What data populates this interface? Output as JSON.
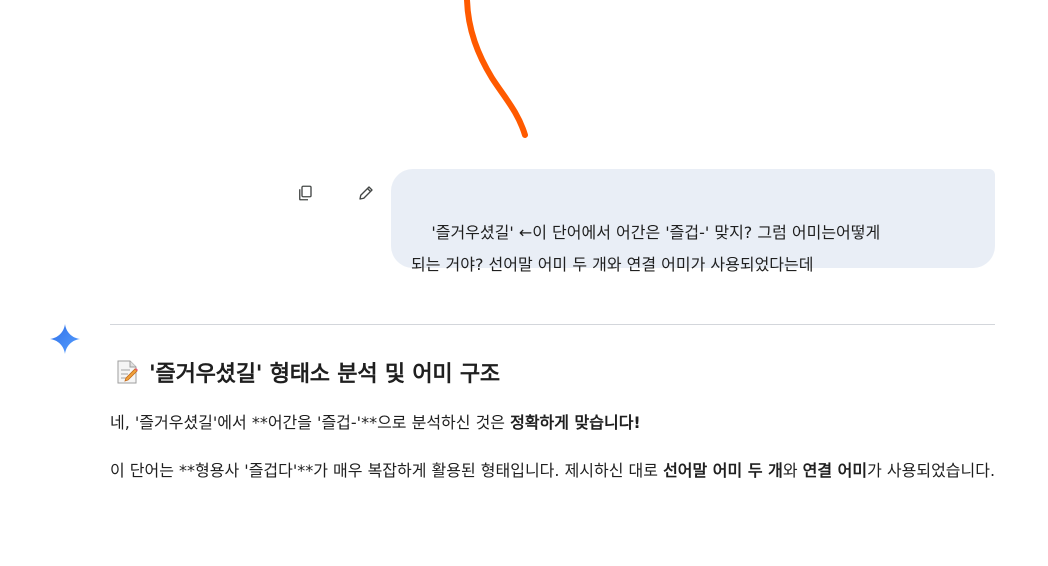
{
  "user_message": {
    "text": "'즐거우셨길' ←이 단어에서 어간은 '즐겁-' 맞지? 그럼 어미는어떻게\n되는 거야? 선어말 어미 두 개와 연결 어미가 사용되었다는데",
    "actions": {
      "copy_icon": "copy-icon",
      "edit_icon": "pencil-icon"
    }
  },
  "assistant": {
    "avatar_icon": "gemini-sparkle-icon",
    "heading": {
      "emoji_icon": "memo-icon",
      "title": "'즐거우셨길' 형태소 분석 및 어미 구조"
    },
    "para1": {
      "text": "네, '즐거우셨길'에서 **어간을 '즐겁-'**으로 분석하신 것은 ",
      "bold": "정확하게 맞습니다!"
    },
    "para2": {
      "text1": "이 단어는 **형용사 '즐겁다'**가 매우 복잡하게 활용된 형태입니다. 제시하신 대로 ",
      "bold1": "선어말 어미 두 개",
      "text2": "와 ",
      "bold2": "연결 어미",
      "text3": "가 사용되었습니다."
    }
  },
  "colors": {
    "bubble_bg": "#e9eef6",
    "annotation": "#ff5a00",
    "gemini_blue": "#3d7ff5",
    "divider": "#d3d6db"
  }
}
